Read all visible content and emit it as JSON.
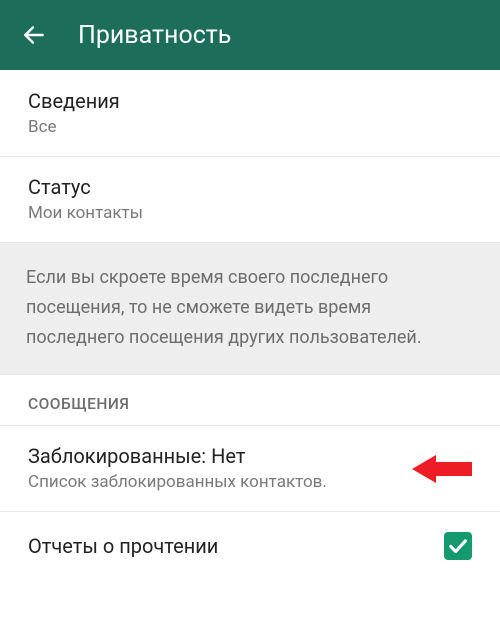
{
  "header": {
    "title": "Приватность"
  },
  "items": {
    "about": {
      "title": "Сведения",
      "subtitle": "Все"
    },
    "status": {
      "title": "Статус",
      "subtitle": "Мои контакты"
    }
  },
  "info": {
    "text": "Если вы скроете время своего последнего посещения, то не сможете видеть время последнего посещения других пользователей."
  },
  "section": {
    "messages": "СООБЩЕНИЯ"
  },
  "blocked": {
    "title": "Заблокированные: Нет",
    "subtitle": "Список заблокированных контактов."
  },
  "readReceipts": {
    "title": "Отчеты о прочтении",
    "checked": true
  },
  "colors": {
    "accent": "#149a6e",
    "headerBg": "#1c6e5b",
    "highlight": "#ee1c25"
  }
}
